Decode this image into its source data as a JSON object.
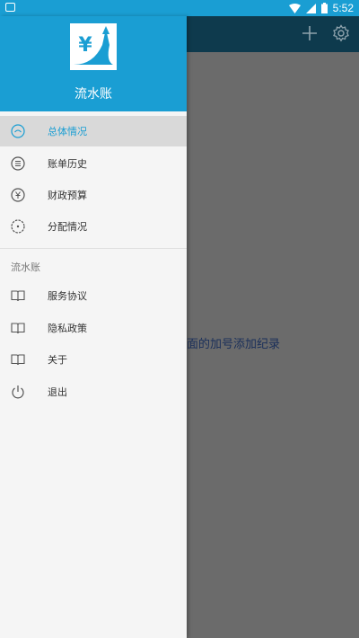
{
  "status_bar": {
    "time": "5:52"
  },
  "app_bar": {
    "add_icon": "plus-icon",
    "settings_icon": "gear-icon"
  },
  "main": {
    "hint_text": "面的加号添加纪录"
  },
  "drawer": {
    "app_name": "流水账",
    "logo_glyph": "¥",
    "primary_items": [
      {
        "label": "总体情况",
        "icon": "overview-icon",
        "active": true
      },
      {
        "label": "账单历史",
        "icon": "history-icon",
        "active": false
      },
      {
        "label": "财政预算",
        "icon": "budget-icon",
        "active": false
      },
      {
        "label": "分配情况",
        "icon": "distribution-icon",
        "active": false
      }
    ],
    "section_title": "流水账",
    "secondary_items": [
      {
        "label": "服务协议",
        "icon": "book-icon"
      },
      {
        "label": "隐私政策",
        "icon": "book-icon"
      },
      {
        "label": "关于",
        "icon": "book-icon"
      },
      {
        "label": "退出",
        "icon": "power-icon"
      }
    ]
  },
  "colors": {
    "primary": "#1a9ed3",
    "app_bar_dark": "#0e3a4d",
    "scrim": "#6b6b6b",
    "drawer_bg": "#f5f5f5",
    "active_item_bg": "#d9d9d9"
  }
}
